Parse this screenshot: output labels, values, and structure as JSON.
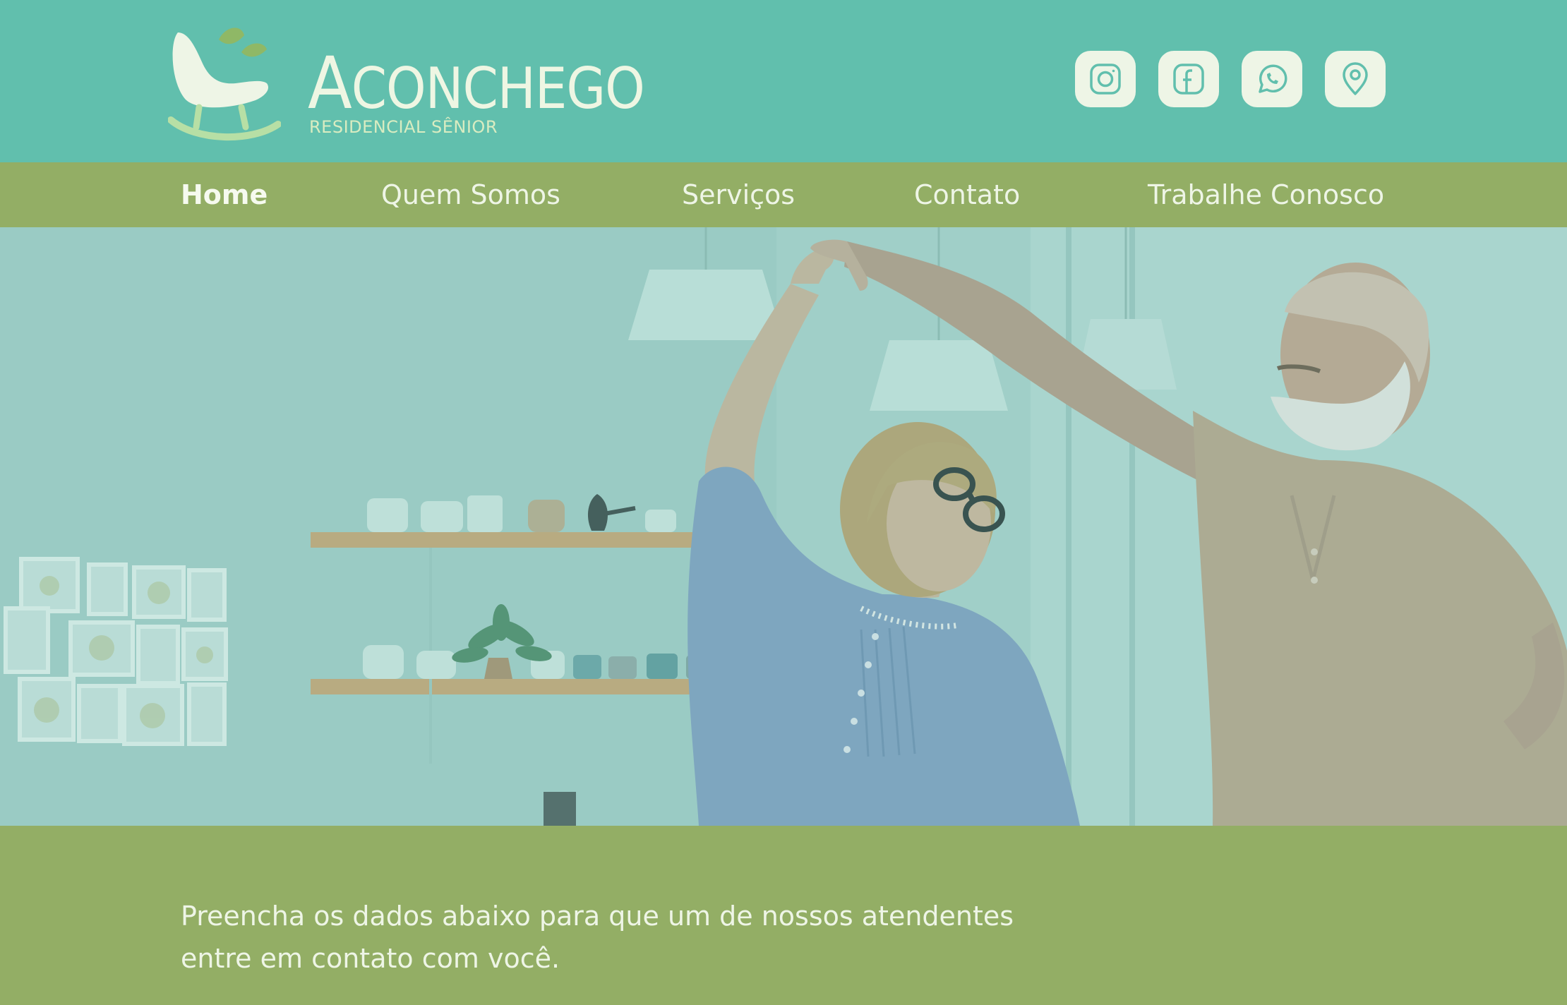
{
  "brand": {
    "name_first": "A",
    "name_rest": "CONCHEGO",
    "subtitle": "RESIDENCIAL SÊNIOR"
  },
  "social": [
    {
      "icon": "instagram-icon",
      "label": "Instagram"
    },
    {
      "icon": "facebook-icon",
      "label": "Facebook"
    },
    {
      "icon": "whatsapp-icon",
      "label": "WhatsApp"
    },
    {
      "icon": "location-icon",
      "label": "Localização"
    }
  ],
  "nav": {
    "items": [
      {
        "label": "Home",
        "active": true
      },
      {
        "label": "Quem Somos",
        "active": false
      },
      {
        "label": "Serviços",
        "active": false
      },
      {
        "label": "Contato",
        "active": false
      },
      {
        "label": "Trabalhe Conosco",
        "active": false
      }
    ]
  },
  "hero": {
    "image": "elderly-couple-dancing-photo"
  },
  "intro": {
    "line1": "Preencha os dados abaixo para que um de nossos atendentes",
    "line2": "entre em contato com você."
  },
  "colors": {
    "header_bg": "#61bfad",
    "nav_bg": "#93ae65",
    "icon_bg": "#eef5e6",
    "icon_stroke": "#61bfad",
    "text_light": "#eef5e6"
  }
}
